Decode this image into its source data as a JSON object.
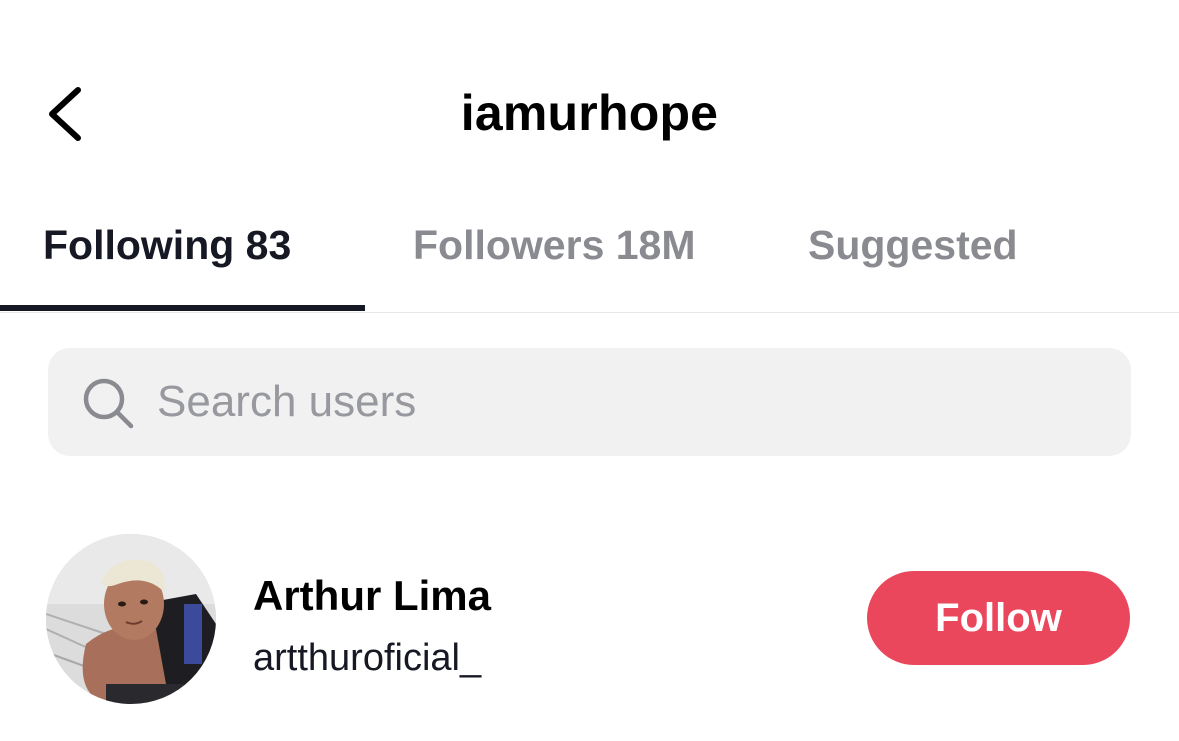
{
  "header": {
    "title": "iamurhope",
    "back_icon": "chevron-left-icon"
  },
  "tabs": [
    {
      "label": "Following 83",
      "active": true
    },
    {
      "label": "Followers 18M",
      "active": false
    },
    {
      "label": "Suggested",
      "active": false
    }
  ],
  "search": {
    "placeholder": "Search users",
    "value": "",
    "icon": "search-icon"
  },
  "users": [
    {
      "name": "Arthur Lima",
      "handle": "artthuroficial_",
      "button_label": "Follow"
    }
  ],
  "colors": {
    "text_primary": "#161823",
    "text_secondary": "#8a8b91",
    "follow_button": "#ea475c",
    "search_bg": "#f1f1f2"
  }
}
